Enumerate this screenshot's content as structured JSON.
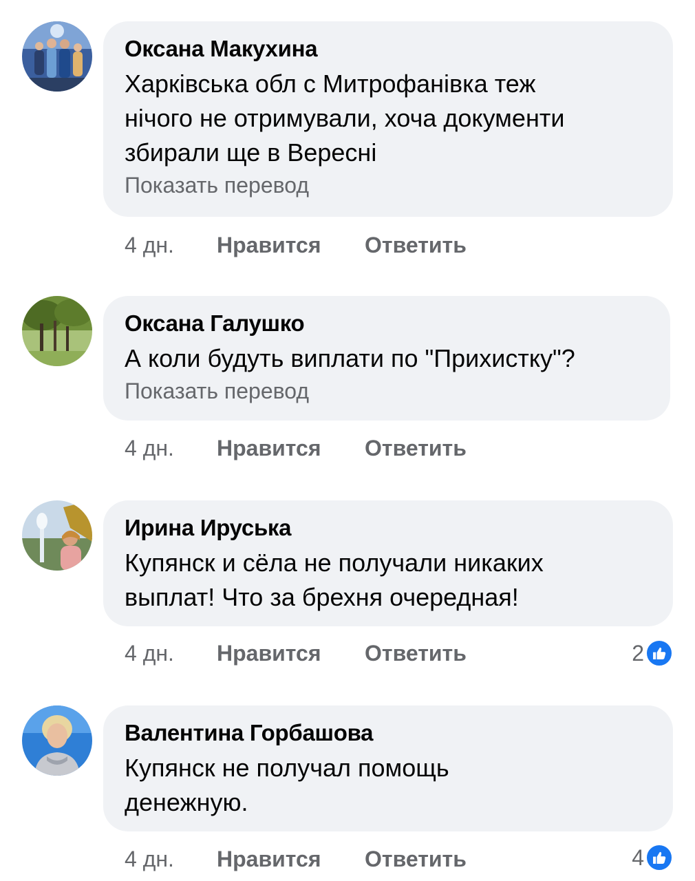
{
  "comments": [
    {
      "author": "Оксана Макухина",
      "text": "Харківська обл с Митрофанівка теж\nнічого не отримували, хоча документи\nзбирали ще в Вересні",
      "translate": "Показать перевод",
      "time": "4 дн.",
      "like_label": "Нравится",
      "reply_label": "Ответить",
      "avatar_icon": "family-photo-avatar"
    },
    {
      "author": "Оксана Галушко",
      "text": "А коли будуть виплати по \"Прихистку\"?",
      "translate": "Показать перевод",
      "time": "4 дн.",
      "like_label": "Нравится",
      "reply_label": "Ответить",
      "avatar_icon": "trees-landscape-avatar"
    },
    {
      "author": "Ирина Ируська",
      "text": "Купянск и сёла не получали никаких\nвыплат! Что за брехня очередная!",
      "time": "4 дн.",
      "like_label": "Нравится",
      "reply_label": "Ответить",
      "reaction_count": "2",
      "reaction_icon": "like-icon",
      "avatar_icon": "woman-fountain-avatar"
    },
    {
      "author": "Валентина Горбашова",
      "text": "Купянск не получал помощь\nденежную.",
      "time": "4 дн.",
      "like_label": "Нравится",
      "reply_label": "Ответить",
      "reaction_count": "4",
      "reaction_icon": "like-icon",
      "avatar_icon": "woman-portrait-avatar"
    }
  ],
  "colors": {
    "bubble": "#f0f2f5",
    "secondary_text": "#65676b",
    "like_blue": "#1877f2"
  }
}
